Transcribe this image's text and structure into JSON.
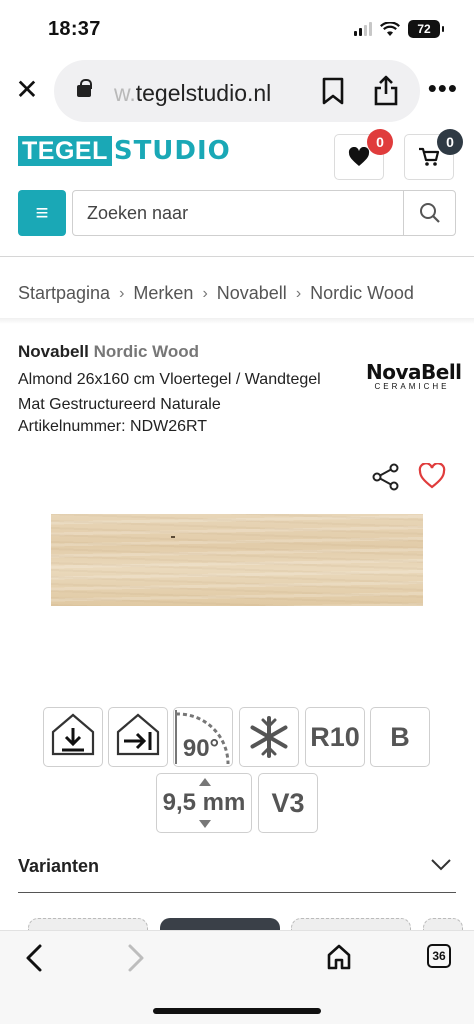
{
  "status_bar": {
    "time": "18:37",
    "battery": "72"
  },
  "browser": {
    "url_faded": "w.",
    "url_main": "tegelstudio.nl",
    "tab_count": "36"
  },
  "site": {
    "logo_part1": "TEGEL",
    "logo_part2": "STUDIO",
    "wishlist_count": "0",
    "cart_count": "0",
    "search_placeholder": "Zoeken naar",
    "brand_color": "#1aa8b6"
  },
  "breadcrumb": [
    "Startpagina",
    "Merken",
    "Novabell",
    "Nordic Wood"
  ],
  "product": {
    "brand": "Novabell",
    "line": "Nordic Wood",
    "description": "Almond 26x160 cm Vloertegel / Wandtegel Mat Gestructureerd Naturale",
    "sku": "Artikelnummer: NDW26RT",
    "brand_logo_name": "NovaBell",
    "brand_logo_sub": "CERAMICHE"
  },
  "features": {
    "angle": "90°",
    "slip": "R10",
    "class": "B",
    "thickness": "9,5 mm",
    "variation": "V3"
  },
  "variants": {
    "label": "Varianten"
  }
}
